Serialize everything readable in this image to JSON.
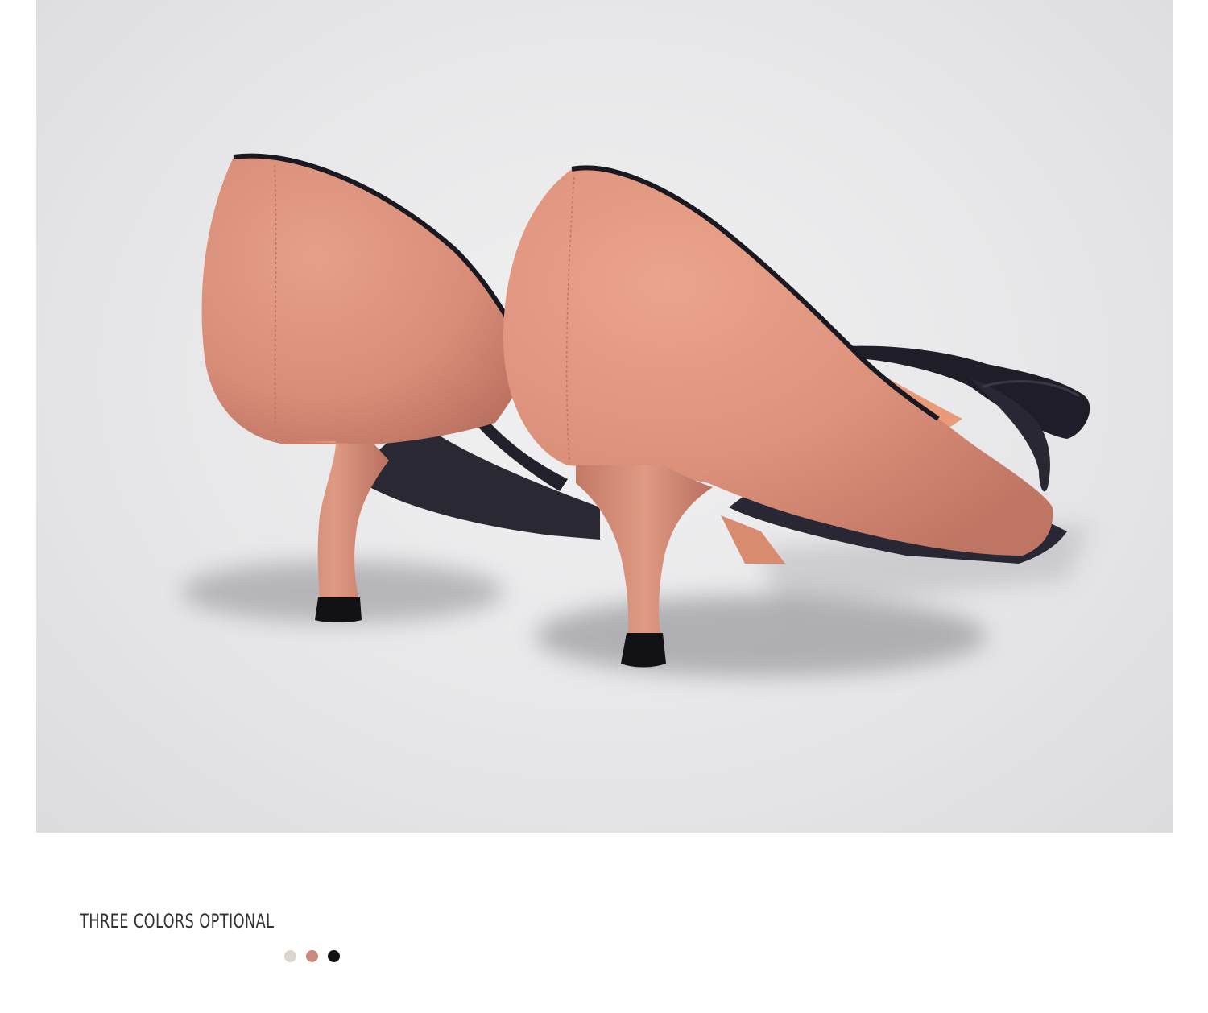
{
  "product": {
    "image_label": "pink suede kitten-heel pumps with black bow, rear view",
    "shoe_color": "#d88d78",
    "accent_color": "#1f1d28"
  },
  "colors_section": {
    "title": "THREE COLORS OPTIONAL",
    "swatches": [
      {
        "name": "beige",
        "color": "#ddd5cc"
      },
      {
        "name": "pink",
        "color": "#c88a7f"
      },
      {
        "name": "black",
        "color": "#111111"
      }
    ]
  }
}
